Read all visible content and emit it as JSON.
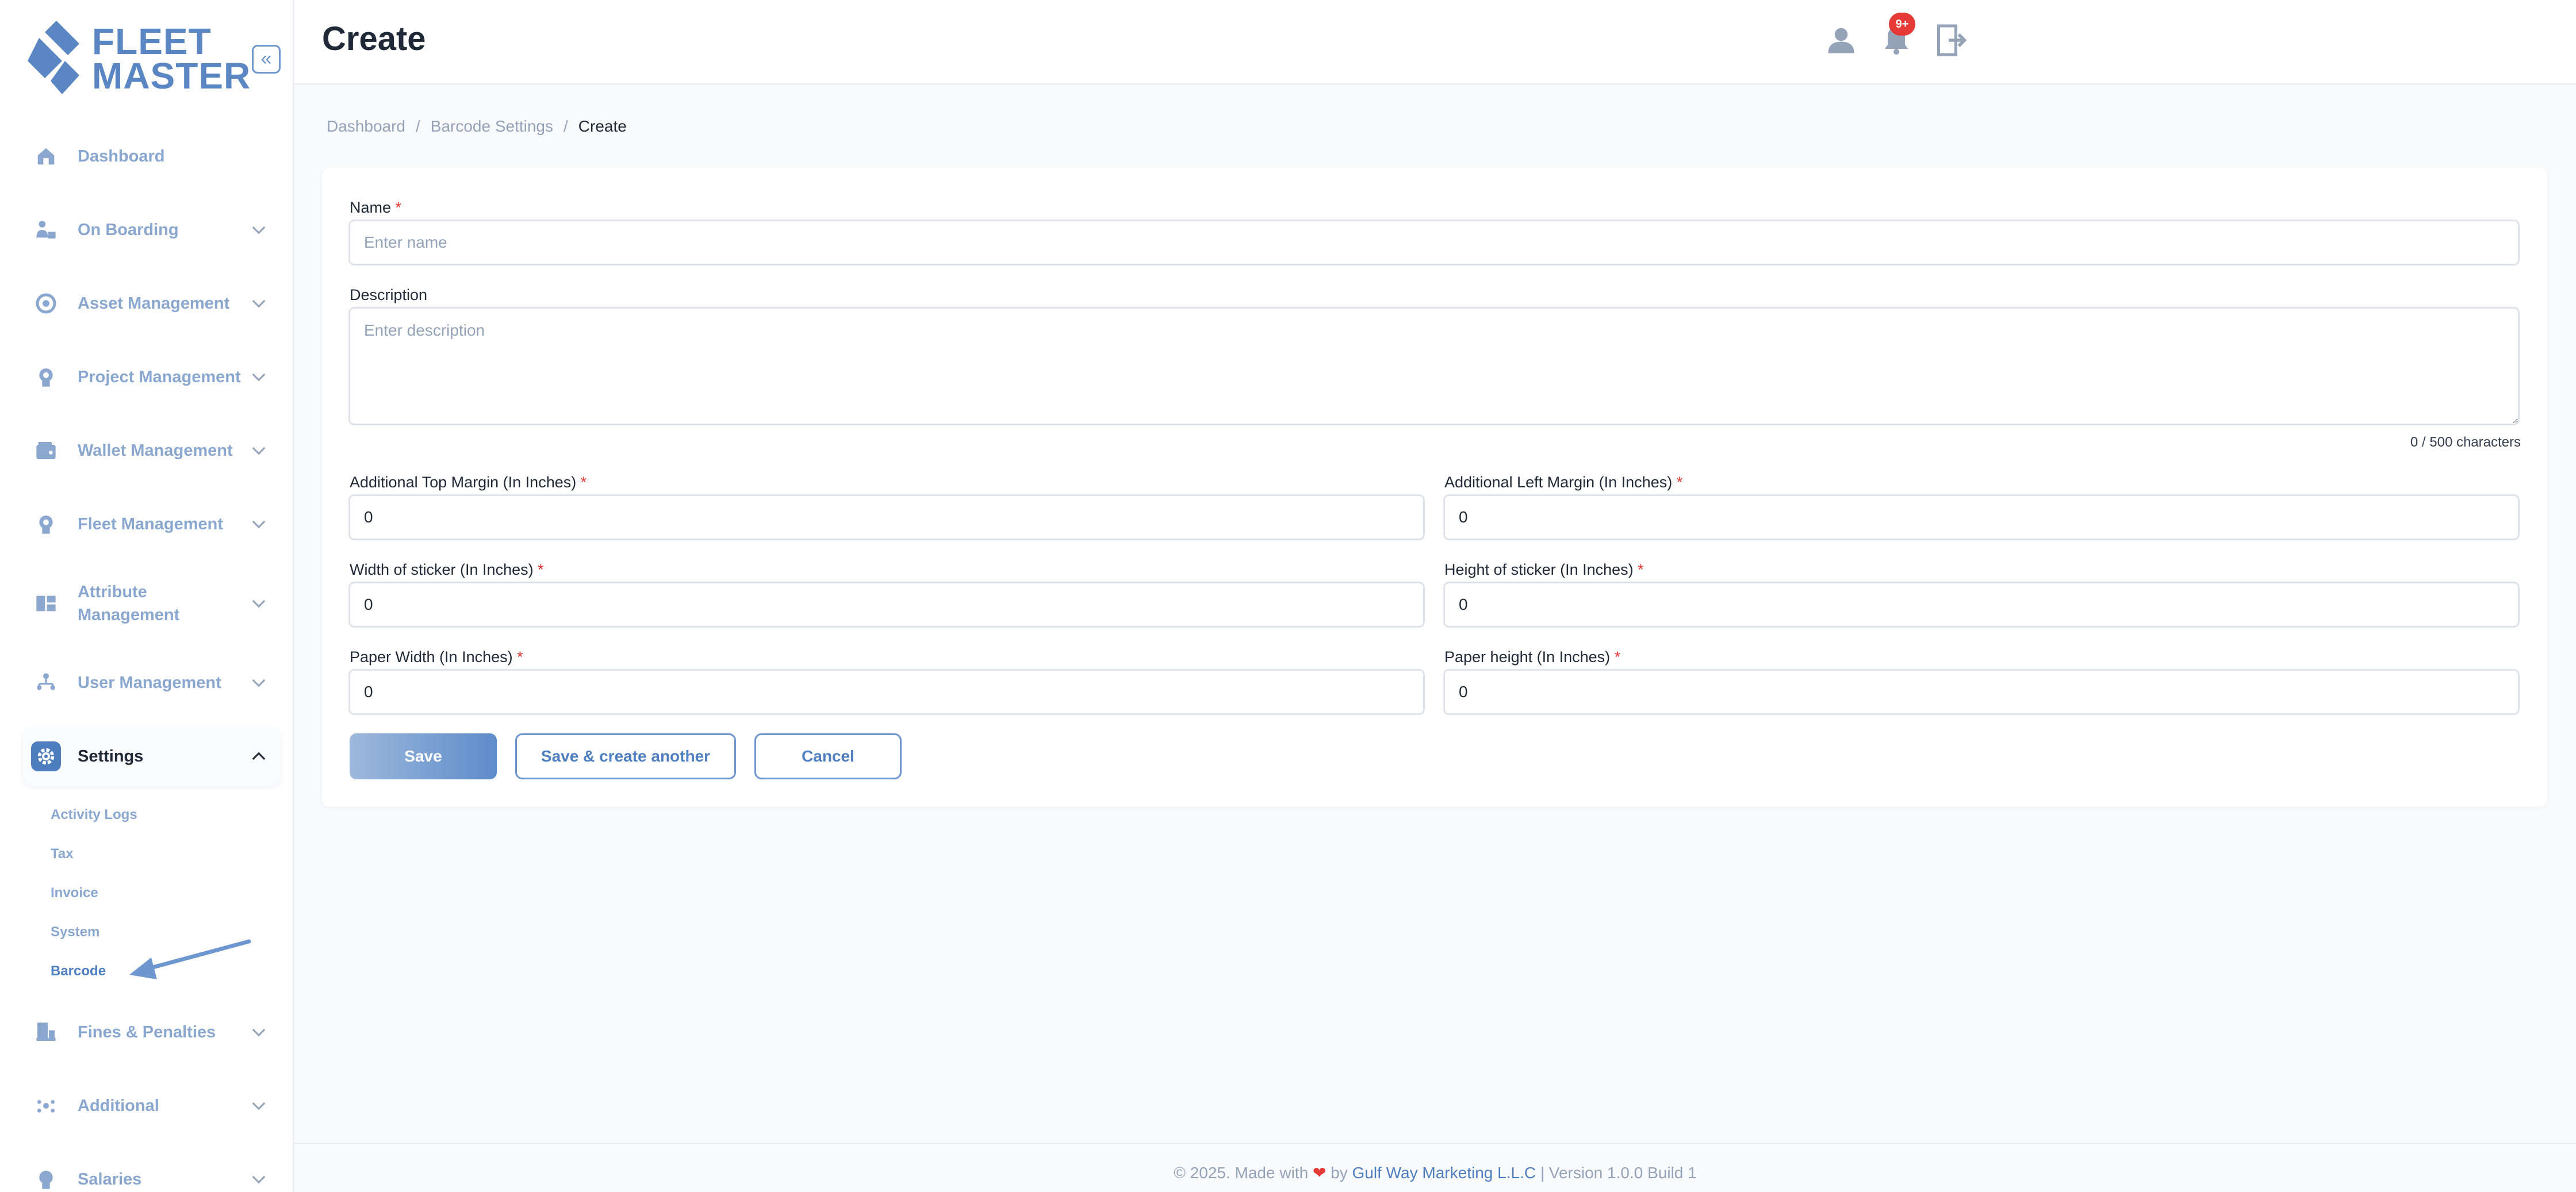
{
  "app": {
    "logo_line1": "FLEET",
    "logo_line2": "MASTER",
    "collapse_glyph": "«"
  },
  "header": {
    "title": "Create",
    "notification_count": "9+"
  },
  "sidebar": {
    "items": [
      {
        "label": "Dashboard",
        "icon": "home-icon"
      },
      {
        "label": "On Boarding",
        "icon": "onboarding-icon"
      },
      {
        "label": "Asset Management",
        "icon": "asset-icon"
      },
      {
        "label": "Project Management",
        "icon": "project-icon"
      },
      {
        "label": "Wallet Management",
        "icon": "wallet-icon"
      },
      {
        "label": "Fleet Management",
        "icon": "fleet-icon"
      },
      {
        "label": "Attribute Management",
        "icon": "attribute-icon"
      },
      {
        "label": "User Management",
        "icon": "users-icon"
      },
      {
        "label": "Settings",
        "icon": "gear-icon"
      },
      {
        "label": "Fines & Penalties",
        "icon": "fines-icon"
      },
      {
        "label": "Additional",
        "icon": "additional-icon"
      },
      {
        "label": "Salaries",
        "icon": "salaries-icon"
      }
    ],
    "settings_sub": [
      "Activity Logs",
      "Tax",
      "Invoice",
      "System",
      "Barcode"
    ]
  },
  "breadcrumb": {
    "items": [
      "Dashboard",
      "Barcode Settings",
      "Create"
    ],
    "separator": "/"
  },
  "form": {
    "name_label": "Name",
    "name_placeholder": "Enter name",
    "description_label": "Description",
    "description_placeholder": "Enter description",
    "char_count": "0 / 500 characters",
    "required_mark": "*",
    "top_margin_label": "Additional Top Margin (In Inches)",
    "left_margin_label": "Additional Left Margin (In Inches)",
    "sticker_width_label": "Width of sticker (In Inches)",
    "sticker_height_label": "Height of sticker (In Inches)",
    "paper_width_label": "Paper Width (In Inches)",
    "paper_height_label": "Paper height (In Inches)",
    "top_margin_value": "0",
    "left_margin_value": "0",
    "sticker_width_value": "0",
    "sticker_height_value": "0",
    "paper_width_value": "0",
    "paper_height_value": "0"
  },
  "actions": {
    "save": "Save",
    "save_another": "Save & create another",
    "cancel": "Cancel"
  },
  "footer": {
    "prefix": "© 2025. Made with",
    "heart": "❤",
    "by": "by",
    "company": "Gulf Way Marketing L.L.C",
    "version": "| Version 1.0.0 Build 1"
  },
  "colors": {
    "accent": "#4e7ec0",
    "nav_text": "#8aa7cf",
    "required": "#e53935"
  }
}
